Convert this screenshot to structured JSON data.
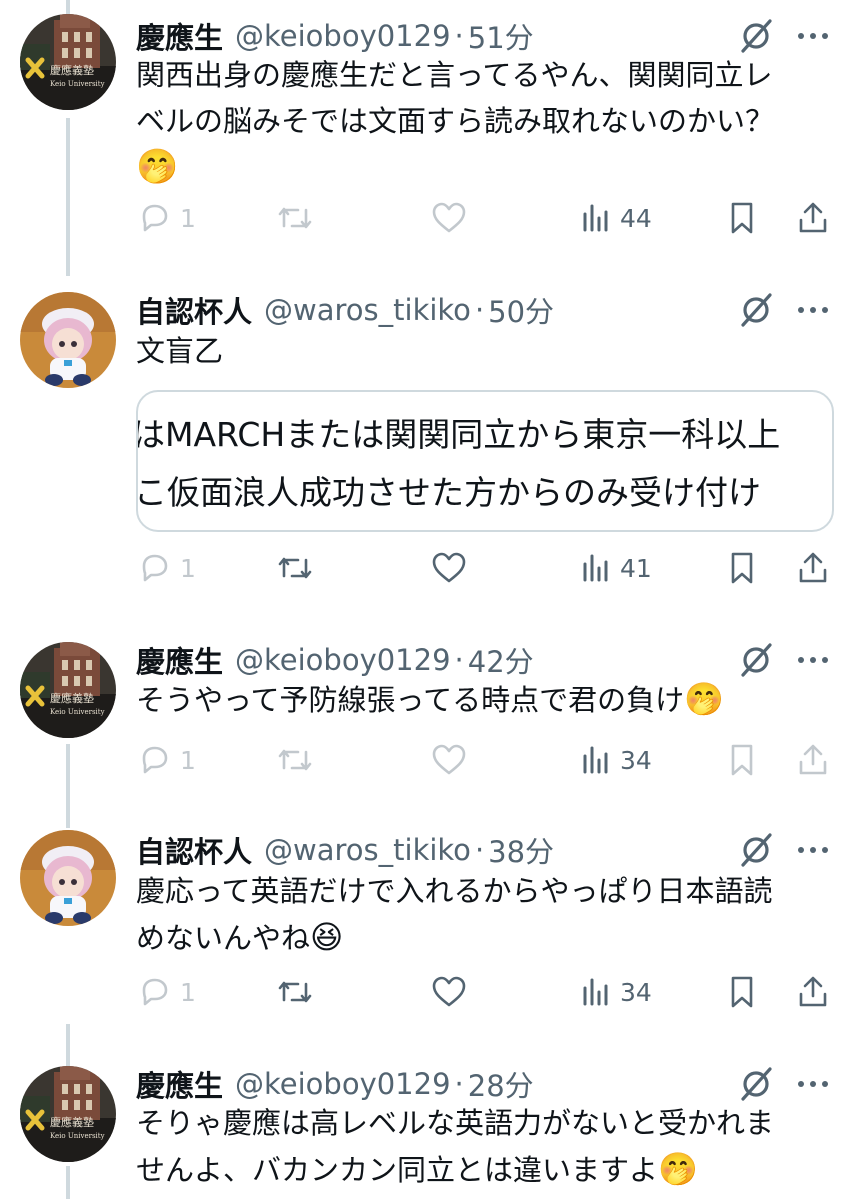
{
  "colors": {
    "text": "#0f1419",
    "secondary": "#536471",
    "line": "#cfd9de"
  },
  "tweets": [
    {
      "name": "慶應生",
      "handle": "@keioboy0129",
      "time": "51分",
      "lines": [
        "関西出身の慶應生だと言ってるやん、関関同立レ",
        "ベルの脳みそでは文面すら読み取れないのかい？"
      ],
      "emoji": "🤭",
      "reply_count": "1",
      "retweet_count": "",
      "like_count": "",
      "view_count": "44",
      "avatar_text": [
        "慶應義塾",
        "Keio University"
      ]
    },
    {
      "name": "自認杯人",
      "handle": "@waros_tikiko",
      "time": "50分",
      "lines": [
        "文盲乙"
      ],
      "quote": [
        "はMARCHまたは関関同立から東京一科以上",
        "こ仮面浪人成功させた方からのみ受け付け"
      ],
      "reply_count": "1",
      "retweet_count": "",
      "like_count": "",
      "view_count": "41"
    },
    {
      "name": "慶應生",
      "handle": "@keioboy0129",
      "time": "42分",
      "lines": [
        "そうやって予防線張ってる時点で君の負け"
      ],
      "emoji": "🤭",
      "reply_count": "1",
      "retweet_count": "",
      "like_count": "",
      "view_count": "34",
      "avatar_text": [
        "慶應義塾",
        "Keio University"
      ]
    },
    {
      "name": "自認杯人",
      "handle": "@waros_tikiko",
      "time": "38分",
      "lines": [
        "慶応って英語だけで入れるからやっぱり日本語読",
        "めないんやね"
      ],
      "emoji": "😆",
      "reply_count": "1",
      "retweet_count": "",
      "like_count": "",
      "view_count": "34"
    },
    {
      "name": "慶應生",
      "handle": "@keioboy0129",
      "time": "28分",
      "lines": [
        "そりゃ慶應は高レベルな英語力がないと受かれま",
        "せんよ、バカンカン同立とは違いますよ"
      ],
      "emoji": "🤭",
      "avatar_text": [
        "慶應義塾",
        "Keio University"
      ]
    }
  ],
  "separator": "·",
  "icons": {
    "reply": "reply-icon",
    "retweet": "retweet-icon",
    "like": "heart-icon",
    "views": "views-icon",
    "bookmark": "bookmark-icon",
    "share": "share-icon",
    "grok": "grok-icon",
    "more": "more-icon"
  }
}
